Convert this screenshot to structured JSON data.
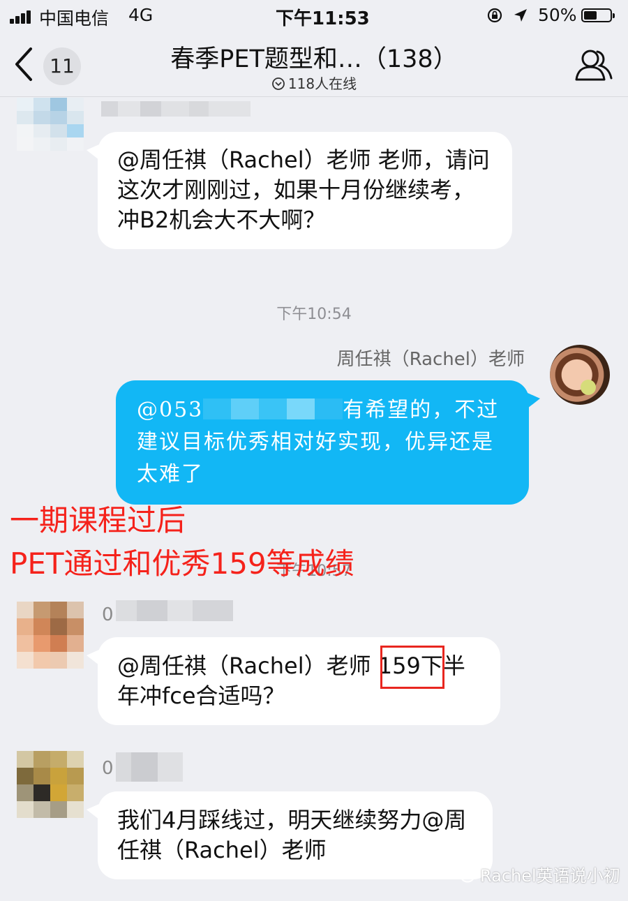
{
  "status_bar": {
    "carrier": "中国电信",
    "network": "4G",
    "time": "下午11:53",
    "battery": "50%",
    "battery_level": 0.5
  },
  "nav": {
    "back_count": "11",
    "title": "春季PET题型和…（138）",
    "online": "118人在线"
  },
  "messages": [
    {
      "text": "@周任祺（Rachel）老师 老师，请问这次才刚刚过，如果十月份继续考，冲B2机会大不大啊？"
    },
    {
      "timestamp": "下午10:54"
    },
    {
      "sender": "周任祺（Rachel）老师",
      "prefix": "@053",
      "text": "有希望的，不过建议目标优秀相对好实现，优异还是太难了"
    },
    {
      "timestamp": "下午10:57"
    },
    {
      "name_prefix": "0",
      "text_before": "@周任祺（Rachel）老师 ",
      "highlight": "159",
      "text_after": "下半年冲fce合适吗？"
    },
    {
      "name_prefix": "0",
      "text": "我们4月踩线过，明天继续努力@周任祺（Rachel）老师"
    }
  ],
  "overlay": {
    "line1": "一期课程过后",
    "line2": "PET通过和优秀159等成绩"
  },
  "watermark": "Rachel英语说小初",
  "colors": {
    "blue_bubble": "#12b7f5",
    "overlay_red": "#f5221b",
    "background": "#eeeff3"
  }
}
